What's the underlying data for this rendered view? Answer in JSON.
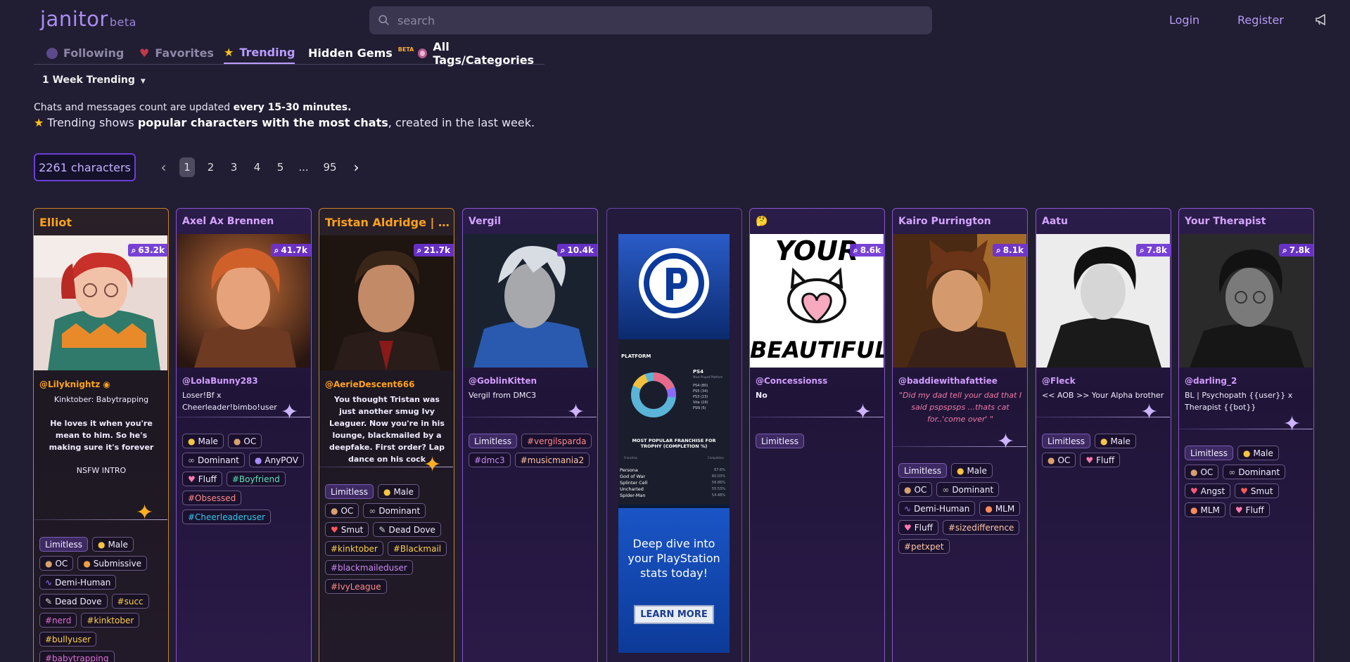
{
  "header": {
    "logo": "janitor",
    "logo_beta": "beta",
    "search_placeholder": "search",
    "login": "Login",
    "register": "Register"
  },
  "tabs": [
    {
      "label": "Following"
    },
    {
      "label": "Favorites"
    },
    {
      "label": "Trending"
    },
    {
      "label": "Hidden Gems",
      "badge": "BETA"
    },
    {
      "label": "All Tags/Categories"
    }
  ],
  "filter": {
    "selected": "1 Week Trending"
  },
  "notes": {
    "line1_a": "Chats and messages count are updated ",
    "line1_b": "every 15-30 minutes.",
    "line2_a": " Trending shows ",
    "line2_b": "popular characters with the most chats",
    "line2_c": ", created in the last week."
  },
  "results": {
    "count_label": "2261 characters"
  },
  "pagination": {
    "pages": [
      "1",
      "2",
      "3",
      "4",
      "5",
      "...",
      "95"
    ],
    "current": "1"
  },
  "cards": [
    {
      "name": "Elliot",
      "chats": "63.2k",
      "author": "@Lilyknightz",
      "tagline": "Kinktober: Babytrapping",
      "desc": "He loves it when you're mean to him. So he's making sure it's forever",
      "extra": "NSFW INTRO",
      "tags": [
        "Limitless",
        "Male",
        "OC",
        "Submissive",
        "Demi-Human",
        "Dead Dove",
        "#succ",
        "#nerd",
        "#kinktober",
        "#bullyuser",
        "#babytrapping"
      ]
    },
    {
      "name": "Axel Ax Brennen",
      "chats": "41.7k",
      "author": "@LolaBunny283",
      "tagline": "Loser!Bf x Cheerleader!bimbo!user",
      "tags": [
        "Male",
        "OC",
        "Dominant",
        "AnyPOV",
        "Fluff",
        "#Boyfriend",
        "#Obsessed",
        "#Cheerleaderuser"
      ]
    },
    {
      "name": "Tristan Aldridge | De...",
      "chats": "21.7k",
      "author": "@AerieDescent666",
      "tagline": "You thought Tristan was just another smug Ivy Leaguer. Now you're in his lounge, blackmailed by a deepfake. First order? Lap dance on his cock",
      "tags": [
        "Limitless",
        "Male",
        "OC",
        "Dominant",
        "Smut",
        "Dead Dove",
        "#kinktober",
        "#Blackmail",
        "#blackmaileduser",
        "#IvyLeague"
      ]
    },
    {
      "name": "Vergil",
      "chats": "10.4k",
      "author": "@GoblinKitten",
      "tagline": "Vergil from DMC3",
      "tags": [
        "Limitless",
        "#vergilsparda",
        "#dmc3",
        "#musicmania2"
      ]
    },
    {
      "name": "🤔",
      "chats": "8.6k",
      "author": "@Concessionss",
      "tagline": "No",
      "image_text_top": "YOUR",
      "image_text_bottom": "BEAUTIFUL",
      "tags": [
        "Limitless"
      ]
    },
    {
      "name": "Kairo Purrington",
      "chats": "8.1k",
      "author": "@baddiewithafattiee",
      "tagline": "\"Did my dad tell your dad that I said pspspsps ...thats cat for..'come over' \"",
      "tags": [
        "Limitless",
        "Male",
        "OC",
        "Dominant",
        "Demi-Human",
        "MLM",
        "Fluff",
        "#sizedifference",
        "#petxpet"
      ]
    },
    {
      "name": "Aatu",
      "chats": "7.8k",
      "author": "@Fleck",
      "tagline": "<< AOB >> Your Alpha brother",
      "tags": [
        "Limitless",
        "Male",
        "OC",
        "Fluff"
      ]
    },
    {
      "name": "Your Therapist",
      "chats": "7.8k",
      "author": "@darling_2",
      "tagline": "BL | Psychopath {{user}} x Therapist {{bot}}",
      "tags": [
        "Limitless",
        "Male",
        "OC",
        "Dominant",
        "Angst",
        "Smut",
        "MLM",
        "Fluff"
      ]
    }
  ],
  "ad": {
    "section": "PLATFORM",
    "legend_title": "PS4",
    "chart_subtitle": "Most Played Platform",
    "legend": [
      "PS4 (80)",
      "PS5 (34)",
      "PS3 (23)",
      "Vita (16)",
      "PSN (5)"
    ],
    "table_title": "MOST POPULAR FRANCHISE FOR TROPHY (COMPLETION %)",
    "table_head": [
      "Franchise",
      "Completion"
    ],
    "rows": [
      {
        "name": "Persona",
        "pct": "67.6%"
      },
      {
        "name": "God of War",
        "pct": "60.03%"
      },
      {
        "name": "Splinter Cell",
        "pct": "58.86%"
      },
      {
        "name": "Uncharted",
        "pct": "55.53%"
      },
      {
        "name": "Spider-Man",
        "pct": "54.48%"
      }
    ],
    "headline": "Deep dive into your PlayStation stats today!",
    "cta": "LEARN MORE"
  },
  "colors": {
    "accent": "#b99cff",
    "background": "#211d33",
    "card_border": "#8a55d0",
    "highlight": "#ffa21a"
  }
}
